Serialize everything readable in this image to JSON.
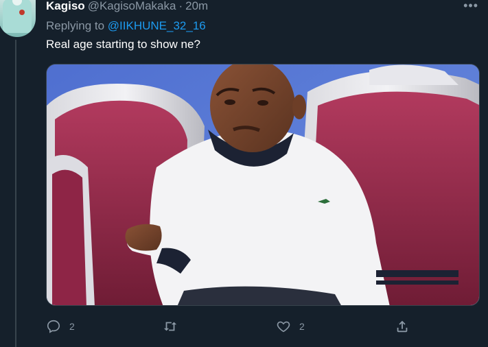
{
  "tweet": {
    "author_name": "Kagiso",
    "author_handle": "@KagisoMakaka",
    "separator": "·",
    "time": "20m",
    "more_label": "•••",
    "replying_prefix": "Replying to",
    "replying_to": "@IIKHUNE_32_16",
    "text": "Real age starting to show ne?"
  },
  "actions": {
    "reply_count": "2",
    "retweet_count": "",
    "like_count": "2"
  },
  "icons": {
    "avatar": "avatar",
    "more": "more-icon",
    "reply": "reply-icon",
    "retweet": "retweet-icon",
    "like": "heart-icon",
    "share": "share-icon"
  },
  "colors": {
    "background": "#15202b",
    "secondary_text": "#8b98a5",
    "accent": "#1d9bf0"
  }
}
